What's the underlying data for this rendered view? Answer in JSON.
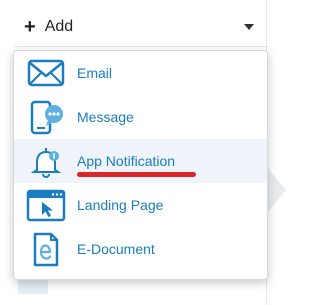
{
  "add_button": {
    "label": "Add"
  },
  "menu": {
    "items": [
      {
        "label": "Email",
        "icon": "envelope-icon"
      },
      {
        "label": "Message",
        "icon": "mobile-message-icon"
      },
      {
        "label": "App Notification",
        "icon": "bell-notification-icon",
        "selected": true
      },
      {
        "label": "Landing Page",
        "icon": "browser-window-icon"
      },
      {
        "label": "E-Document",
        "icon": "e-document-icon"
      }
    ]
  },
  "colors": {
    "accent": "#1a7dbf",
    "highlight_underline": "#d9262a",
    "selected_bg": "#eef4f9"
  }
}
